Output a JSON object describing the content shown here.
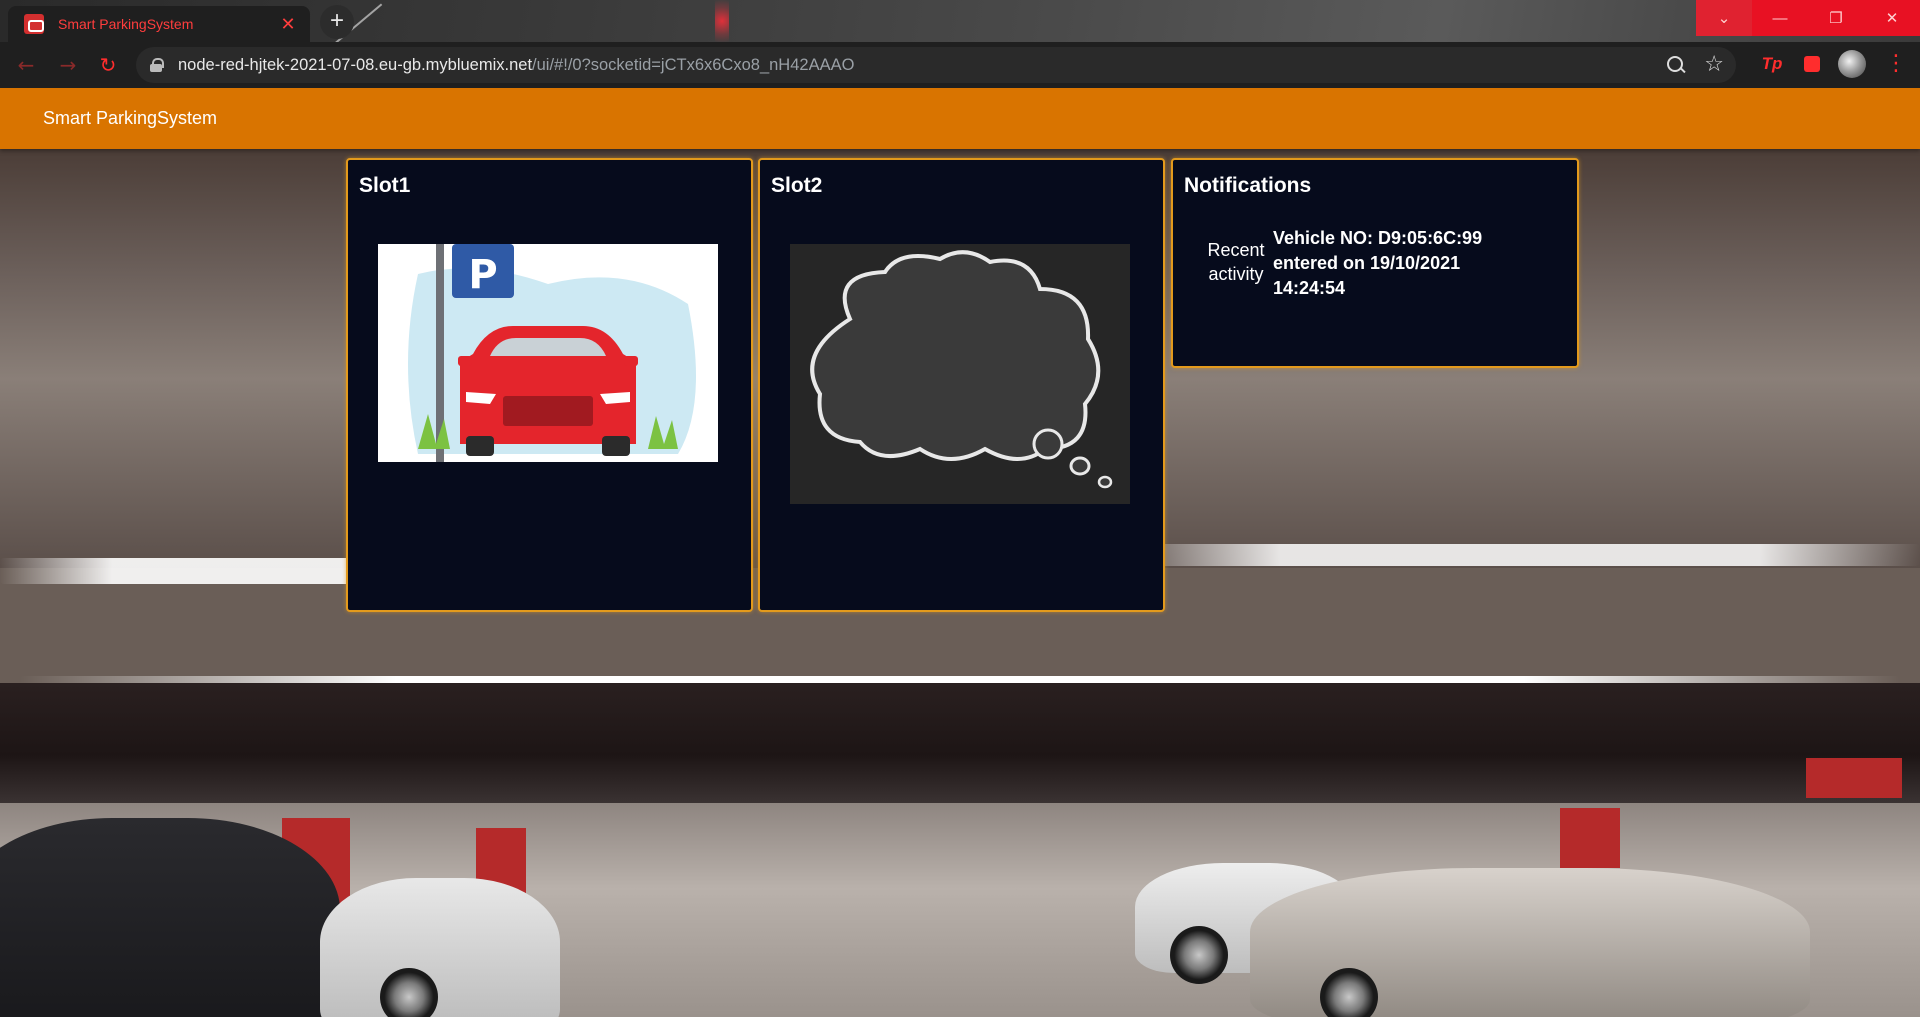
{
  "browser": {
    "tab_title": "Smart ParkingSystem",
    "tab_close": "✕",
    "new_tab": "+",
    "url_host": "node-red-hjtek-2021-07-08.eu-gb.mybluemix.net",
    "url_path": "/ui/#!/0?socketid=jCTx6x6Cxo8_nH42AAAO",
    "extensions": [
      "Tp"
    ],
    "window_controls": [
      "⌄",
      "—",
      "❐",
      "✕"
    ],
    "accent_color": "#ff2d2d"
  },
  "header": {
    "title": "Smart ParkingSystem",
    "color": "#d97400"
  },
  "cards": {
    "slot1": {
      "title": "Slot1",
      "image": "parking-car-illustration"
    },
    "slot2": {
      "title": "Slot2",
      "image": "chalkboard-thought-bubble"
    },
    "notifications": {
      "title": "Notifications",
      "label": "Recent activity",
      "message": "Vehicle NO: D9:05:6C:99 entered on 19/10/2021 14:24:54"
    }
  },
  "colors": {
    "card_background": "#060b1c",
    "card_border": "#e39a1c"
  }
}
